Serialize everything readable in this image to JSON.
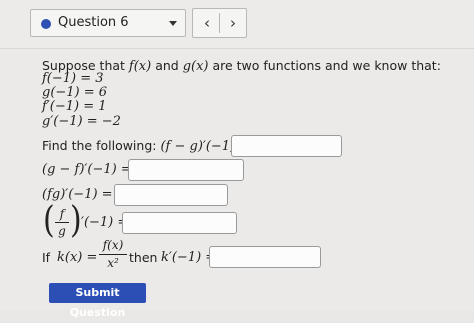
{
  "header": {
    "question_label": "Question 6",
    "prev_symbol": "‹",
    "next_symbol": "›",
    "dot_color": "#2f4fb3"
  },
  "problem": {
    "intro_text": "Suppose that ",
    "intro_f": "f(x)",
    "intro_and": " and ",
    "intro_g": "g(x)",
    "intro_rest": " are two functions and we know that:",
    "givens": [
      "f(−1) = 3",
      "g(−1) = 6",
      "f′(−1) = 1",
      "g′(−1) = −2"
    ],
    "find_text": "Find the following: ",
    "find_expr": "(f − g)′(−1) =",
    "q2_expr": "(g − f)′(−1) =",
    "q3_expr": "(fg)′(−1) =",
    "q4_num": "f",
    "q4_den": "g",
    "q4_tail": "′(−1) =",
    "q5_if": "If ",
    "q5_k": "k(x) =",
    "q5_num": "f(x)",
    "q5_den": "x²",
    "q5_then": " then ",
    "q5_tail": "k′(−1) ="
  },
  "submit_label": "Submit Question",
  "accent_color": "#2c4fb5"
}
